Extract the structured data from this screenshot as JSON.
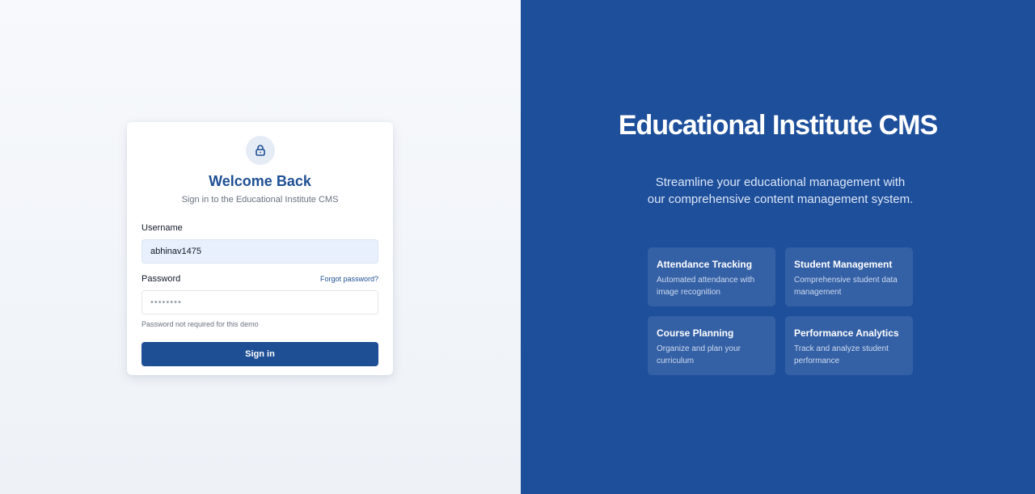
{
  "login": {
    "icon": "lock-icon",
    "title": "Welcome Back",
    "subtitle": "Sign in to the Educational Institute CMS",
    "username_label": "Username",
    "username_value": "abhinav1475",
    "password_label": "Password",
    "forgot_link": "Forgot password?",
    "password_value": "••••••••",
    "password_hint": "Password not required for this demo",
    "signin_label": "Sign in"
  },
  "hero": {
    "title": "Educational Institute CMS",
    "subtitle": "Streamline your educational management with our comprehensive content management system.",
    "features": [
      {
        "title": "Attendance Tracking",
        "description": "Automated attendance with image recognition"
      },
      {
        "title": "Student Management",
        "description": "Comprehensive student data management"
      },
      {
        "title": "Course Planning",
        "description": "Organize and plan your curriculum"
      },
      {
        "title": "Performance Analytics",
        "description": "Track and analyze student performance"
      }
    ]
  },
  "colors": {
    "brand": "#1e4f95",
    "panel": "#1e4f9b",
    "input_fill": "#e8f0fe"
  }
}
